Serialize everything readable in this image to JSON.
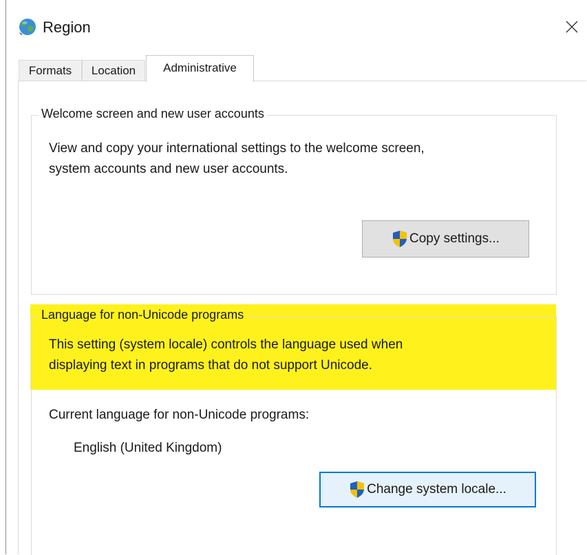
{
  "window": {
    "title": "Region",
    "icon": "globe-icon",
    "close_icon": "close-icon"
  },
  "tabs": [
    {
      "label": "Formats",
      "active": false
    },
    {
      "label": "Location",
      "active": false
    },
    {
      "label": "Administrative",
      "active": true
    }
  ],
  "welcome_group": {
    "title": "Welcome screen and new user accounts",
    "description_line1": "View and copy your international settings to the welcome screen,",
    "description_line2": "system accounts and new user accounts.",
    "button_label": "Copy settings...",
    "button_icon": "uac-shield-icon"
  },
  "locale_group": {
    "title": "Language for non-Unicode programs",
    "description_line1": "This setting (system locale) controls the language used when",
    "description_line2": "displaying text in programs that do not support Unicode.",
    "current_label": "Current language for non-Unicode programs:",
    "current_value": "English (United Kingdom)",
    "button_label": "Change system locale...",
    "button_icon": "uac-shield-icon",
    "highlight_color": "#fff21c"
  }
}
